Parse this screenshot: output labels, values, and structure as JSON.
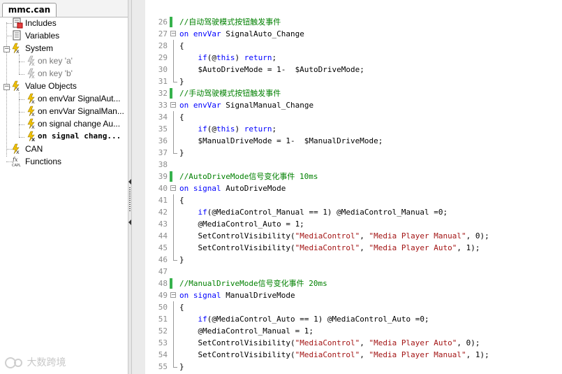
{
  "tab": {
    "label": "mmc.can"
  },
  "tree": {
    "items": [
      {
        "label": "Includes"
      },
      {
        "label": "Variables"
      },
      {
        "label": "System"
      },
      {
        "label": "on key 'a'"
      },
      {
        "label": "on key 'b'"
      },
      {
        "label": "Value Objects"
      },
      {
        "label": "on envVar SignalAut..."
      },
      {
        "label": "on envVar SignalMan..."
      },
      {
        "label": "on signal change Au..."
      },
      {
        "label": "on signal chang..."
      },
      {
        "label": "CAN"
      },
      {
        "label": "Functions"
      }
    ]
  },
  "editor": {
    "lines": [
      {
        "n": "26",
        "segs": [
          {
            "t": "//自动驾驶模式按钮触发事件",
            "c": "cm"
          }
        ],
        "mark": true
      },
      {
        "n": "27",
        "segs": [
          {
            "t": "on envVar",
            "c": "kw"
          },
          {
            "t": " SignalAuto_Change",
            "c": ""
          }
        ]
      },
      {
        "n": "28",
        "segs": [
          {
            "t": "{",
            "c": ""
          }
        ]
      },
      {
        "n": "29",
        "segs": [
          {
            "t": "    if",
            "c": "kw"
          },
          {
            "t": "(@",
            "c": ""
          },
          {
            "t": "this",
            "c": "kw"
          },
          {
            "t": ") ",
            "c": ""
          },
          {
            "t": "return",
            "c": "kw"
          },
          {
            "t": ";",
            "c": ""
          }
        ]
      },
      {
        "n": "30",
        "segs": [
          {
            "t": "    $AutoDriveMode = 1-  $AutoDriveMode;",
            "c": ""
          }
        ]
      },
      {
        "n": "31",
        "segs": [
          {
            "t": "}",
            "c": ""
          }
        ]
      },
      {
        "n": "32",
        "segs": [
          {
            "t": "//手动驾驶模式按钮触发事件",
            "c": "cm"
          }
        ],
        "mark": true
      },
      {
        "n": "33",
        "segs": [
          {
            "t": "on envVar",
            "c": "kw"
          },
          {
            "t": " SignalManual_Change",
            "c": ""
          }
        ]
      },
      {
        "n": "34",
        "segs": [
          {
            "t": "{",
            "c": ""
          }
        ]
      },
      {
        "n": "35",
        "segs": [
          {
            "t": "    if",
            "c": "kw"
          },
          {
            "t": "(@",
            "c": ""
          },
          {
            "t": "this",
            "c": "kw"
          },
          {
            "t": ") ",
            "c": ""
          },
          {
            "t": "return",
            "c": "kw"
          },
          {
            "t": ";",
            "c": ""
          }
        ]
      },
      {
        "n": "36",
        "segs": [
          {
            "t": "    $ManualDriveMode = 1-  $ManualDriveMode;",
            "c": ""
          }
        ]
      },
      {
        "n": "37",
        "segs": [
          {
            "t": "}",
            "c": ""
          }
        ]
      },
      {
        "n": "38",
        "segs": []
      },
      {
        "n": "39",
        "segs": [
          {
            "t": "//AutoDriveMode信号变化事件 10ms",
            "c": "cm"
          }
        ],
        "mark": true
      },
      {
        "n": "40",
        "segs": [
          {
            "t": "on signal",
            "c": "kw"
          },
          {
            "t": " AutoDriveMode",
            "c": ""
          }
        ]
      },
      {
        "n": "41",
        "segs": [
          {
            "t": "{",
            "c": ""
          }
        ]
      },
      {
        "n": "42",
        "segs": [
          {
            "t": "    if",
            "c": "kw"
          },
          {
            "t": "(@MediaControl_Manual == 1) @MediaControl_Manual =0;",
            "c": ""
          }
        ]
      },
      {
        "n": "43",
        "segs": [
          {
            "t": "    @MediaControl_Auto = 1;",
            "c": ""
          }
        ]
      },
      {
        "n": "44",
        "segs": [
          {
            "t": "    SetControlVisibility(",
            "c": ""
          },
          {
            "t": "\"MediaControl\"",
            "c": "str"
          },
          {
            "t": ", ",
            "c": ""
          },
          {
            "t": "\"Media Player Manual\"",
            "c": "str"
          },
          {
            "t": ", 0);",
            "c": ""
          }
        ]
      },
      {
        "n": "45",
        "segs": [
          {
            "t": "    SetControlVisibility(",
            "c": ""
          },
          {
            "t": "\"MediaControl\"",
            "c": "str"
          },
          {
            "t": ", ",
            "c": ""
          },
          {
            "t": "\"Media Player Auto\"",
            "c": "str"
          },
          {
            "t": ", 1);",
            "c": ""
          }
        ]
      },
      {
        "n": "46",
        "segs": [
          {
            "t": "}",
            "c": ""
          }
        ]
      },
      {
        "n": "47",
        "segs": []
      },
      {
        "n": "48",
        "segs": [
          {
            "t": "//ManualDriveMode信号变化事件 20ms",
            "c": "cm"
          }
        ],
        "mark": true
      },
      {
        "n": "49",
        "segs": [
          {
            "t": "on signal",
            "c": "kw"
          },
          {
            "t": " ManualDriveMode",
            "c": ""
          }
        ]
      },
      {
        "n": "50",
        "segs": [
          {
            "t": "{",
            "c": ""
          }
        ]
      },
      {
        "n": "51",
        "segs": [
          {
            "t": "    if",
            "c": "kw"
          },
          {
            "t": "(@MediaControl_Auto == 1) @MediaControl_Auto =0;",
            "c": ""
          }
        ]
      },
      {
        "n": "52",
        "segs": [
          {
            "t": "    @MediaControl_Manual = 1;",
            "c": ""
          }
        ]
      },
      {
        "n": "53",
        "segs": [
          {
            "t": "    SetControlVisibility(",
            "c": ""
          },
          {
            "t": "\"MediaControl\"",
            "c": "str"
          },
          {
            "t": ", ",
            "c": ""
          },
          {
            "t": "\"Media Player Auto\"",
            "c": "str"
          },
          {
            "t": ", 0);",
            "c": ""
          }
        ]
      },
      {
        "n": "54",
        "segs": [
          {
            "t": "    SetControlVisibility(",
            "c": ""
          },
          {
            "t": "\"MediaControl\"",
            "c": "str"
          },
          {
            "t": ", ",
            "c": ""
          },
          {
            "t": "\"Media Player Manual\"",
            "c": "str"
          },
          {
            "t": ", 1);",
            "c": ""
          }
        ]
      },
      {
        "n": "55",
        "segs": [
          {
            "t": "}",
            "c": ""
          }
        ]
      }
    ]
  },
  "watermark": "大数跨境",
  "colors": {
    "keyword": "#0000ff",
    "comment": "#008000",
    "string": "#a31515",
    "change_marker": "#37b24d"
  }
}
